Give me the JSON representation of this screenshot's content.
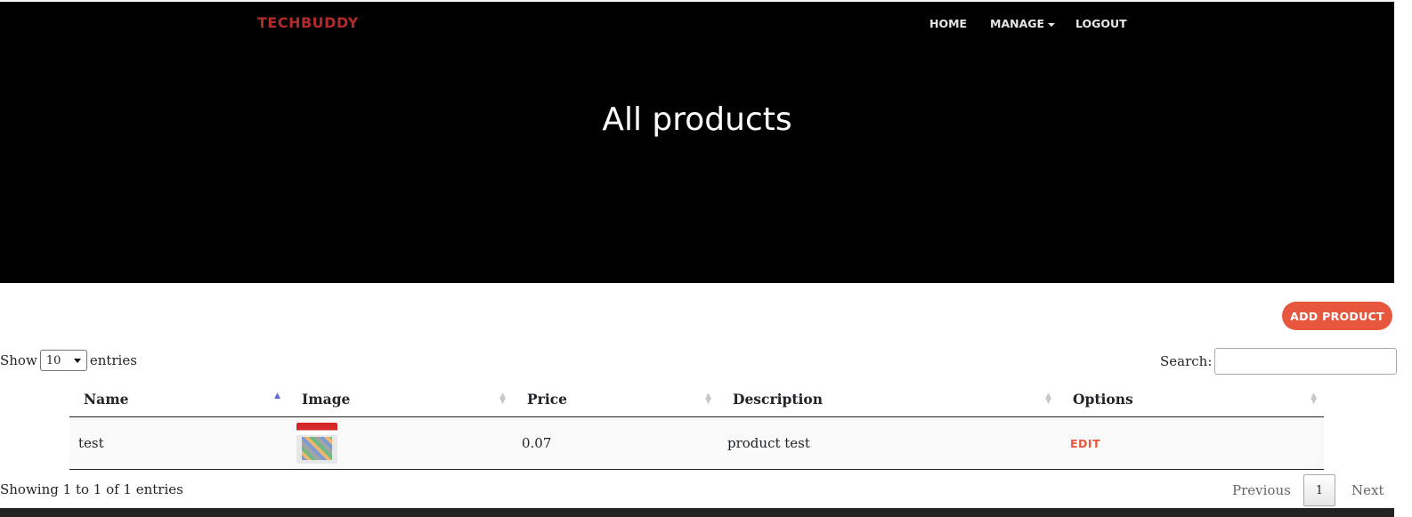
{
  "brand": "TECHBUDDY",
  "nav": {
    "home": "HOME",
    "manage": "MANAGE",
    "logout": "LOGOUT"
  },
  "hero": {
    "title": "All products"
  },
  "actions": {
    "add_product": "ADD PRODUCT"
  },
  "length_control": {
    "show": "Show",
    "value": "10",
    "entries": "entries"
  },
  "search": {
    "label": "Search:",
    "value": ""
  },
  "table": {
    "headers": [
      "Name",
      "Image",
      "Price",
      "Description",
      "Options"
    ],
    "rows": [
      {
        "name": "test",
        "image": "product-image",
        "price": "0.07",
        "description": "product test",
        "option": "EDIT"
      }
    ]
  },
  "info": "Showing 1 to 1 of 1 entries",
  "pagination": {
    "previous": "Previous",
    "current": "1",
    "next": "Next"
  },
  "colors": {
    "brand": "#b32a2a",
    "accent": "#e6573e",
    "hero_bg": "#000000"
  }
}
